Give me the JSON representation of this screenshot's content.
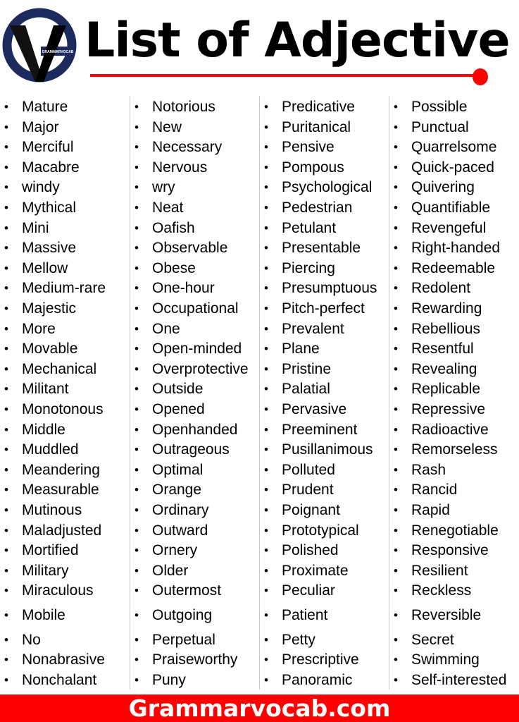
{
  "header": {
    "logo_text": "GRAMMARVOCAB",
    "title": "List of Adjective",
    "colors": {
      "logo_ring": "#1c2a5e",
      "accent": "#ff0000"
    }
  },
  "columns": [
    [
      "Mature",
      "Major",
      "Merciful",
      "Macabre",
      "windy",
      "Mythical",
      "Mini",
      "Massive",
      "Mellow",
      "Medium-rare",
      "Majestic",
      "More",
      "Movable",
      "Mechanical",
      "Militant",
      "Monotonous",
      "Middle",
      "Muddled",
      "Meandering",
      "Measurable",
      "Mutinous",
      "Maladjusted",
      "Mortified",
      "Military",
      "Miraculous",
      "Mobile",
      "No",
      "Nonabrasive",
      "Nonchalant"
    ],
    [
      "Notorious",
      "New",
      "Necessary",
      "Nervous",
      "wry",
      "Neat",
      "Oafish",
      "Observable",
      "Obese",
      "One-hour",
      "Occupational",
      "One",
      "Open-minded",
      "Overprotective",
      "Outside",
      "Opened",
      "Openhanded",
      "Outrageous",
      "Optimal",
      "Orange",
      "Ordinary",
      "Outward",
      "Ornery",
      "Older",
      "Outermost",
      "Outgoing",
      "Perpetual",
      "Praiseworthy",
      "Puny"
    ],
    [
      "Predicative",
      "Puritanical",
      "Pensive",
      "Pompous",
      "Psychological",
      "Pedestrian",
      "Petulant",
      "Presentable",
      "Piercing",
      "Presumptuous",
      "Pitch-perfect",
      "Prevalent",
      "Plane",
      "Pristine",
      "Palatial",
      "Pervasive",
      "Preeminent",
      "Pusillanimous",
      "Polluted",
      "Prudent",
      "Poignant",
      "Prototypical",
      "Polished",
      "Proximate",
      "Peculiar",
      "Patient",
      "Petty",
      "Prescriptive",
      "Panoramic"
    ],
    [
      "Possible",
      "Punctual",
      "Quarrelsome",
      "Quick-paced",
      "Quivering",
      "Quantifiable",
      "Revengeful",
      "Right-handed",
      "Redeemable",
      "Redolent",
      "Rewarding",
      "Rebellious",
      "Resentful",
      "Revealing",
      "Replicable",
      "Repressive",
      "Radioactive",
      "Remorseless",
      "Rash",
      "Rancid",
      "Rapid",
      "Renegotiable",
      "Responsive",
      "Resilient",
      "Reckless",
      "Reversible",
      "Secret",
      "Swimming",
      "Self-interested"
    ]
  ],
  "bullet": "•",
  "footer": {
    "text": "Grammarvocab.com"
  }
}
